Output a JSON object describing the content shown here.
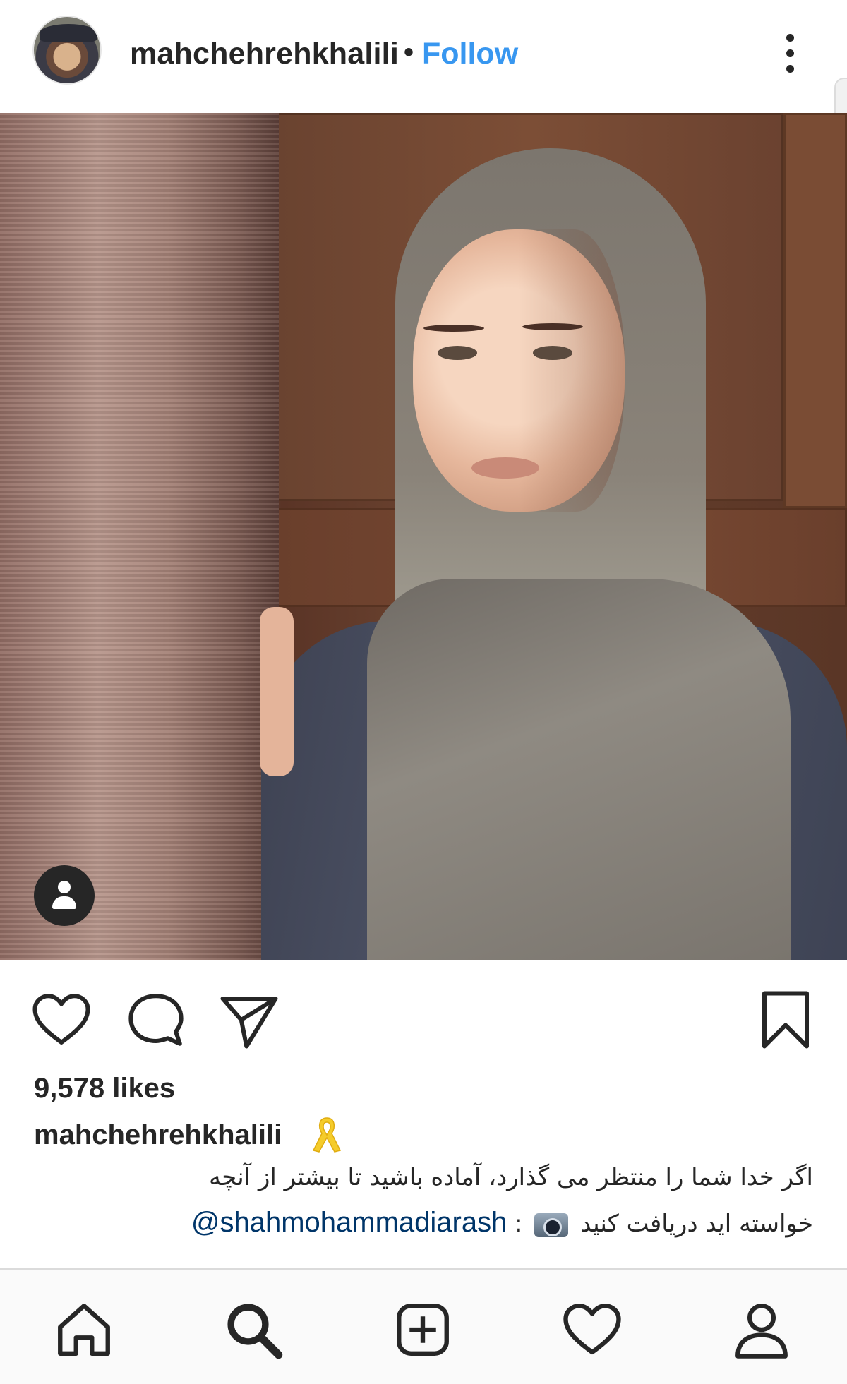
{
  "header": {
    "username": "mahchehrehkhalili",
    "separator": "•",
    "follow_label": "Follow"
  },
  "post": {
    "likes": "9,578 likes",
    "caption_username": "mahchehrehkhalili",
    "caption_line1": "اگر خدا شما را منتظر می گذارد، آماده باشید تا بیشتر از آنچه",
    "caption_line2": "خواسته اید دریافت کنید",
    "mention": "@shahmohammadiarash",
    "colon": ":"
  },
  "colors": {
    "accent": "#3897f0",
    "mention": "#003569",
    "text": "#262626"
  },
  "icons": {
    "post_actions": [
      "heart-icon",
      "comment-icon",
      "share-icon",
      "bookmark-icon"
    ],
    "bottom_nav": [
      "home-icon",
      "search-icon",
      "add-post-icon",
      "activity-icon",
      "profile-icon"
    ],
    "overlay": "user-tag-icon",
    "menu": "more-options-icon"
  }
}
